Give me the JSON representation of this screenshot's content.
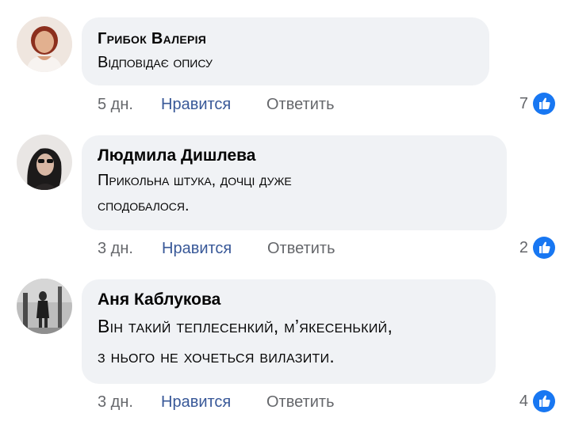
{
  "comments": [
    {
      "author": "Грибок Валерія",
      "text": [
        "Відповідає опису"
      ],
      "time": "5 дн.",
      "like_label": "Нравится",
      "reply_label": "Ответить",
      "reactions": "7"
    },
    {
      "author": "Людмила Дишлева",
      "text": [
        "Прикольна штука, дочці дуже",
        "сподобалося."
      ],
      "time": "3 дн.",
      "like_label": "Нравится",
      "reply_label": "Ответить",
      "reactions": "2"
    },
    {
      "author": "Аня Каблукова",
      "text": [
        "Він такий теплесенкий, м’якесенький,",
        "з нього не хочеться вилазити."
      ],
      "time": "3 дн.",
      "like_label": "Нравится",
      "reply_label": "Ответить",
      "reactions": "4"
    }
  ],
  "colors": {
    "bubble": "#f0f2f5",
    "like_blue": "#1877f2",
    "link_blue": "#385898",
    "meta_gray": "#65676b"
  },
  "icons": [
    "like-thumb-icon"
  ]
}
